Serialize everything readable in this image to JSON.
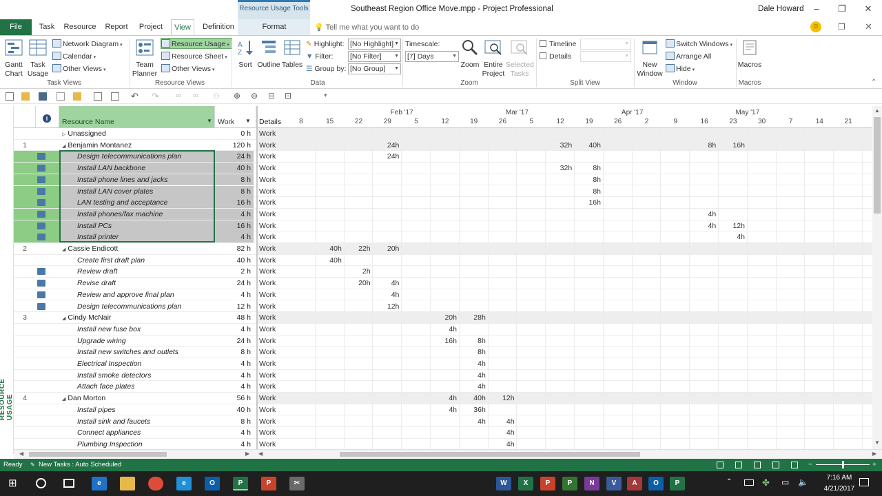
{
  "window": {
    "document_title": "Southeast Region Office Move.mpp  -  Project Professional",
    "context_tab_group": "Resource Usage Tools",
    "user_name": "Dale Howard"
  },
  "ribbon_tabs": [
    "File",
    "Task",
    "Resource",
    "Report",
    "Project",
    "View",
    "Definition",
    "Format"
  ],
  "tell_me": "Tell me what you want to do",
  "ribbon": {
    "task_views": {
      "label": "Task Views",
      "gantt": "Gantt Chart",
      "task_usage": "Task Usage",
      "network_diagram": "Network Diagram",
      "calendar": "Calendar",
      "other_views": "Other Views"
    },
    "resource_views": {
      "label": "Resource Views",
      "team_planner": "Team Planner",
      "resource_usage": "Resource Usage",
      "resource_sheet": "Resource Sheet",
      "other_views": "Other Views"
    },
    "data": {
      "label": "Data",
      "sort": "Sort",
      "outline": "Outline",
      "tables": "Tables",
      "highlight_label": "Highlight:",
      "highlight_value": "[No Highlight]",
      "filter_label": "Filter:",
      "filter_value": "[No Filter]",
      "group_label": "Group by:",
      "group_value": "[No Group]"
    },
    "zoom": {
      "label": "Zoom",
      "timescale_label": "Timescale:",
      "timescale_value": "[7] Days",
      "zoom": "Zoom",
      "entire_project": "Entire Project",
      "selected_tasks": "Selected Tasks"
    },
    "split_view": {
      "label": "Split View",
      "timeline": "Timeline",
      "details": "Details"
    },
    "window": {
      "label": "Window",
      "new_window": "New Window",
      "switch_windows": "Switch Windows",
      "arrange_all": "Arrange All",
      "hide": "Hide"
    },
    "macros": {
      "label": "Macros",
      "macros": "Macros"
    }
  },
  "side_label": "RESOURCE USAGE",
  "sheet": {
    "headers": {
      "resource_name": "Resource Name",
      "work": "Work",
      "details": "Details"
    },
    "rows": [
      {
        "id": "",
        "name": "Unassigned",
        "work": "0 h",
        "detail": "Work",
        "type": "res",
        "values": {}
      },
      {
        "id": "1",
        "name": "Benjamin Montanez",
        "work": "120 h",
        "detail": "Work",
        "type": "res",
        "values": {
          "29": "24h",
          "12m": "32h",
          "19m": "40h",
          "16a": "8h",
          "23a": "16h"
        }
      },
      {
        "id": "",
        "name": "Design telecommunications plan",
        "work": "24 h",
        "detail": "Work",
        "type": "asg",
        "sel": true,
        "values": {
          "29": "24h"
        }
      },
      {
        "id": "",
        "name": "Install LAN backbone",
        "work": "40 h",
        "detail": "Work",
        "type": "asg",
        "sel": true,
        "values": {
          "12m": "32h",
          "19m": "8h"
        }
      },
      {
        "id": "",
        "name": "Install phone lines and jacks",
        "work": "8 h",
        "detail": "Work",
        "type": "asg",
        "sel": true,
        "values": {
          "19m": "8h"
        }
      },
      {
        "id": "",
        "name": "Install LAN cover plates",
        "work": "8 h",
        "detail": "Work",
        "type": "asg",
        "sel": true,
        "values": {
          "19m": "8h"
        }
      },
      {
        "id": "",
        "name": "LAN testing and acceptance",
        "work": "16 h",
        "detail": "Work",
        "type": "asg",
        "sel": true,
        "values": {
          "19m": "16h"
        }
      },
      {
        "id": "",
        "name": "Install phones/fax machine",
        "work": "4 h",
        "detail": "Work",
        "type": "asg",
        "sel": true,
        "values": {
          "16a": "4h"
        }
      },
      {
        "id": "",
        "name": "Install PCs",
        "work": "16 h",
        "detail": "Work",
        "type": "asg",
        "sel": true,
        "values": {
          "16a": "4h",
          "23a": "12h"
        }
      },
      {
        "id": "",
        "name": "Install printer",
        "work": "4 h",
        "detail": "Work",
        "type": "asg",
        "sel": true,
        "values": {
          "23a": "4h"
        }
      },
      {
        "id": "2",
        "name": "Cassie Endicott",
        "work": "82 h",
        "detail": "Work",
        "type": "res",
        "values": {
          "15": "40h",
          "22": "22h",
          "29": "20h"
        }
      },
      {
        "id": "",
        "name": "Create first draft plan",
        "work": "40 h",
        "detail": "Work",
        "type": "asg",
        "values": {
          "15": "40h"
        }
      },
      {
        "id": "",
        "name": "Review draft",
        "work": "2 h",
        "detail": "Work",
        "type": "asg",
        "ind": true,
        "values": {
          "22": "2h"
        }
      },
      {
        "id": "",
        "name": "Revise draft",
        "work": "24 h",
        "detail": "Work",
        "type": "asg",
        "ind": true,
        "values": {
          "22": "20h",
          "29": "4h"
        }
      },
      {
        "id": "",
        "name": "Review and approve final plan",
        "work": "4 h",
        "detail": "Work",
        "type": "asg",
        "ind": true,
        "values": {
          "29": "4h"
        }
      },
      {
        "id": "",
        "name": "Design telecommunications plan",
        "work": "12 h",
        "detail": "Work",
        "type": "asg",
        "ind": true,
        "values": {
          "29": "12h"
        }
      },
      {
        "id": "3",
        "name": "Cindy McNair",
        "work": "48 h",
        "detail": "Work",
        "type": "res",
        "values": {
          "12f": "20h",
          "19f": "28h"
        }
      },
      {
        "id": "",
        "name": "Install new fuse box",
        "work": "4 h",
        "detail": "Work",
        "type": "asg",
        "values": {
          "12f": "4h"
        }
      },
      {
        "id": "",
        "name": "Upgrade wiring",
        "work": "24 h",
        "detail": "Work",
        "type": "asg",
        "values": {
          "12f": "16h",
          "19f": "8h"
        }
      },
      {
        "id": "",
        "name": "Install new switches and outlets",
        "work": "8 h",
        "detail": "Work",
        "type": "asg",
        "values": {
          "19f": "8h"
        }
      },
      {
        "id": "",
        "name": "Electrical Inspection",
        "work": "4 h",
        "detail": "Work",
        "type": "asg",
        "values": {
          "19f": "4h"
        }
      },
      {
        "id": "",
        "name": "Install smoke detectors",
        "work": "4 h",
        "detail": "Work",
        "type": "asg",
        "values": {
          "19f": "4h"
        }
      },
      {
        "id": "",
        "name": "Attach face plates",
        "work": "4 h",
        "detail": "Work",
        "type": "asg",
        "values": {
          "19f": "4h"
        }
      },
      {
        "id": "4",
        "name": "Dan Morton",
        "work": "56 h",
        "detail": "Work",
        "type": "res",
        "values": {
          "12f": "4h",
          "19f": "40h",
          "26f": "12h"
        }
      },
      {
        "id": "",
        "name": "Install pipes",
        "work": "40 h",
        "detail": "Work",
        "type": "asg",
        "values": {
          "12f": "4h",
          "19f": "36h"
        }
      },
      {
        "id": "",
        "name": "Install sink and faucets",
        "work": "8 h",
        "detail": "Work",
        "type": "asg",
        "values": {
          "19f": "4h",
          "26f": "4h"
        }
      },
      {
        "id": "",
        "name": "Connect appliances",
        "work": "4 h",
        "detail": "Work",
        "type": "asg",
        "values": {
          "26f": "4h"
        }
      },
      {
        "id": "",
        "name": "Plumbing Inspection",
        "work": "4 h",
        "detail": "Work",
        "type": "asg",
        "values": {
          "26f": "4h"
        }
      }
    ]
  },
  "timescale": {
    "months": [
      {
        "label": "Feb '17",
        "col": 4
      },
      {
        "label": "Mar '17",
        "col": 8
      },
      {
        "label": "Apr '17",
        "col": 12
      },
      {
        "label": "May '17",
        "col": 16
      }
    ],
    "days": [
      "8",
      "15",
      "22",
      "29",
      "5",
      "12",
      "19",
      "26",
      "5",
      "12",
      "19",
      "26",
      "2",
      "9",
      "16",
      "23",
      "30",
      "7",
      "14",
      "21"
    ],
    "keys": [
      "8",
      "15",
      "22",
      "29",
      "5f",
      "12f",
      "19f",
      "26f",
      "5m",
      "12m",
      "19m",
      "26m",
      "2a",
      "9a",
      "16a",
      "23a",
      "30a",
      "7y",
      "14y",
      "21y"
    ]
  },
  "status": {
    "ready": "Ready",
    "new_tasks": "New Tasks : Auto Scheduled"
  },
  "taskbar": {
    "time": "7:16 AM",
    "date": "4/21/2017"
  }
}
